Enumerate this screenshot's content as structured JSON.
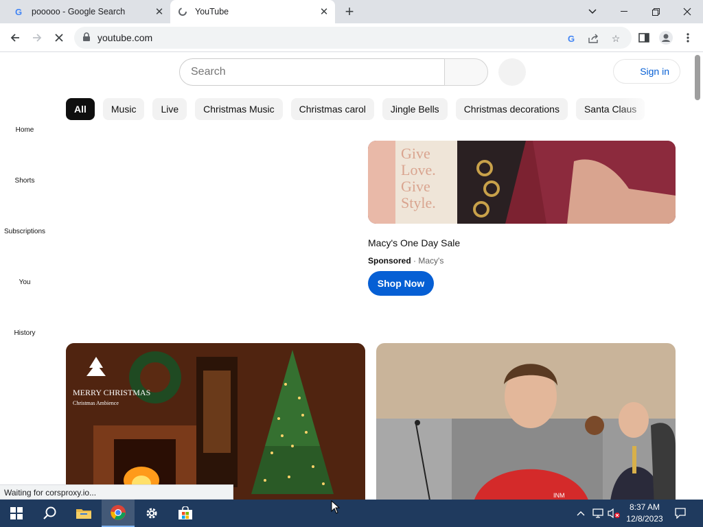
{
  "browser": {
    "tabs": [
      {
        "title": "pooooo - Google Search",
        "favicon": "google-icon",
        "active": false
      },
      {
        "title": "YouTube",
        "favicon": "loading-icon",
        "active": true
      }
    ],
    "url": "youtube.com",
    "status_text": "Waiting for corsproxy.io..."
  },
  "youtube": {
    "search_placeholder": "Search",
    "signin_label": "Sign in",
    "chips": [
      "All",
      "Music",
      "Live",
      "Christmas Music",
      "Christmas carol",
      "Jingle Bells",
      "Christmas decorations",
      "Santa Claus"
    ],
    "selected_chip": "All",
    "guide": [
      "Home",
      "Shorts",
      "Subscriptions",
      "You",
      "History"
    ],
    "ad": {
      "title": "Macy's One Day Sale",
      "sponsored": "Sponsored",
      "separator": "·",
      "advertiser": "Macy's",
      "cta": "Shop Now",
      "image_text": [
        "Give",
        "Love.",
        "Give",
        "Style."
      ]
    },
    "videos": [
      {
        "thumbnail_caption": "MERRY CHRISTMAS",
        "thumbnail_sub": "Christmas Ambience"
      },
      {
        "thumbnail_caption": "INM"
      }
    ]
  },
  "taskbar": {
    "time": "8:37 AM",
    "date": "12/8/2023",
    "apps": [
      "start-icon",
      "search-icon",
      "file-explorer-icon",
      "chrome-icon",
      "settings-icon",
      "store-icon"
    ]
  },
  "colors": {
    "yt_blue": "#065fd4",
    "chip_bg": "#f2f2f2",
    "chip_selected": "#0f0f0f",
    "taskbar": "#1f3a5e"
  }
}
